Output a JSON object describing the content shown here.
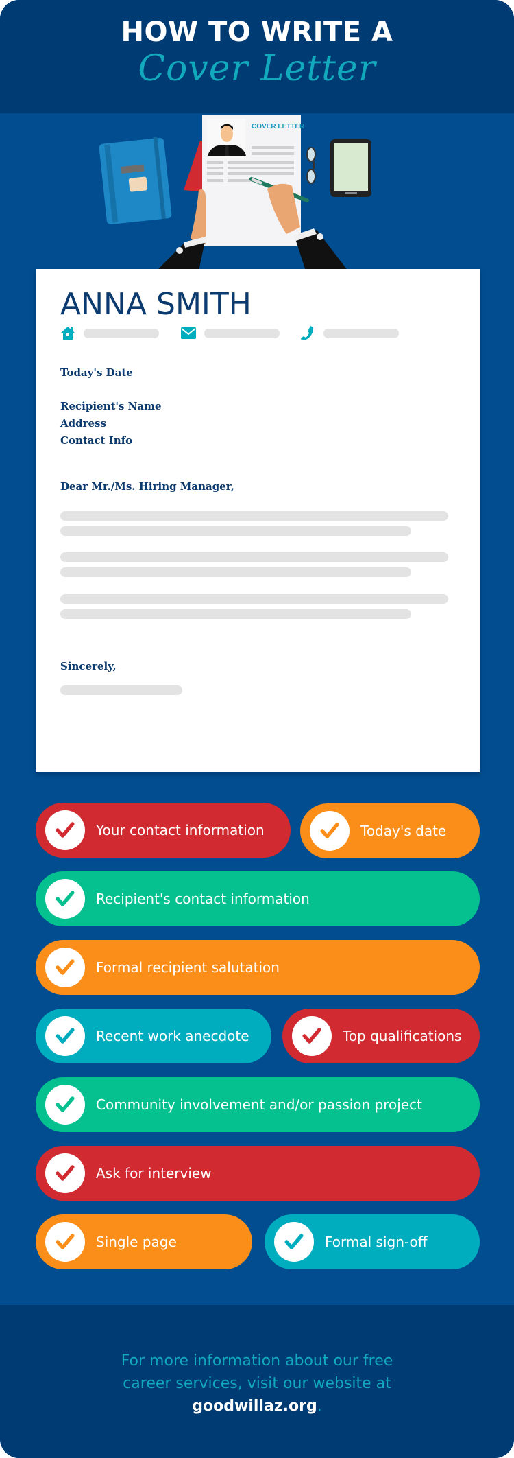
{
  "header": {
    "title_line1": "HOW TO WRITE A",
    "title_line2": "Cover Letter"
  },
  "illustration": {
    "document_heading": "COVER LETTER",
    "items": [
      "notebook-icon",
      "resume-document",
      "pen-icon",
      "glasses-icon",
      "tablet-icon",
      "hands"
    ]
  },
  "letter": {
    "name": "ANNA SMITH",
    "contact_icons": [
      "home-icon",
      "envelope-icon",
      "phone-icon"
    ],
    "date_label": "Today's Date",
    "recipient_name": "Recipient's Name",
    "address": "Address",
    "contact_info": "Contact Info",
    "salutation": "Dear Mr./Ms. Hiring Manager,",
    "closing": "Sincerely,"
  },
  "checklist": [
    {
      "label": "Your contact information",
      "color": "#d12b31"
    },
    {
      "label": "Today's date",
      "color": "#fb8e19"
    },
    {
      "label": "Recipient's contact information",
      "color": "#05c190"
    },
    {
      "label": "Formal recipient salutation",
      "color": "#fb8e19"
    },
    {
      "label": "Recent work anecdote",
      "color": "#00adbf"
    },
    {
      "label": "Top qualifications",
      "color": "#d12b31"
    },
    {
      "label": "Community involvement and/or passion project",
      "color": "#05c190"
    },
    {
      "label": "Ask for interview",
      "color": "#d12b31"
    },
    {
      "label": "Single page",
      "color": "#fb8e19"
    },
    {
      "label": "Formal sign-off",
      "color": "#00adbf"
    }
  ],
  "footer": {
    "line1": "For more information about our free",
    "line2": "career services, visit our website at",
    "url": "goodwillaz.org",
    "period": "."
  },
  "colors": {
    "navy": "#003b73",
    "blue": "#014d8f",
    "teal": "#12a9bd",
    "red": "#d12b31",
    "orange": "#fb8e19",
    "green": "#05c190",
    "cyan": "#00adbf"
  }
}
